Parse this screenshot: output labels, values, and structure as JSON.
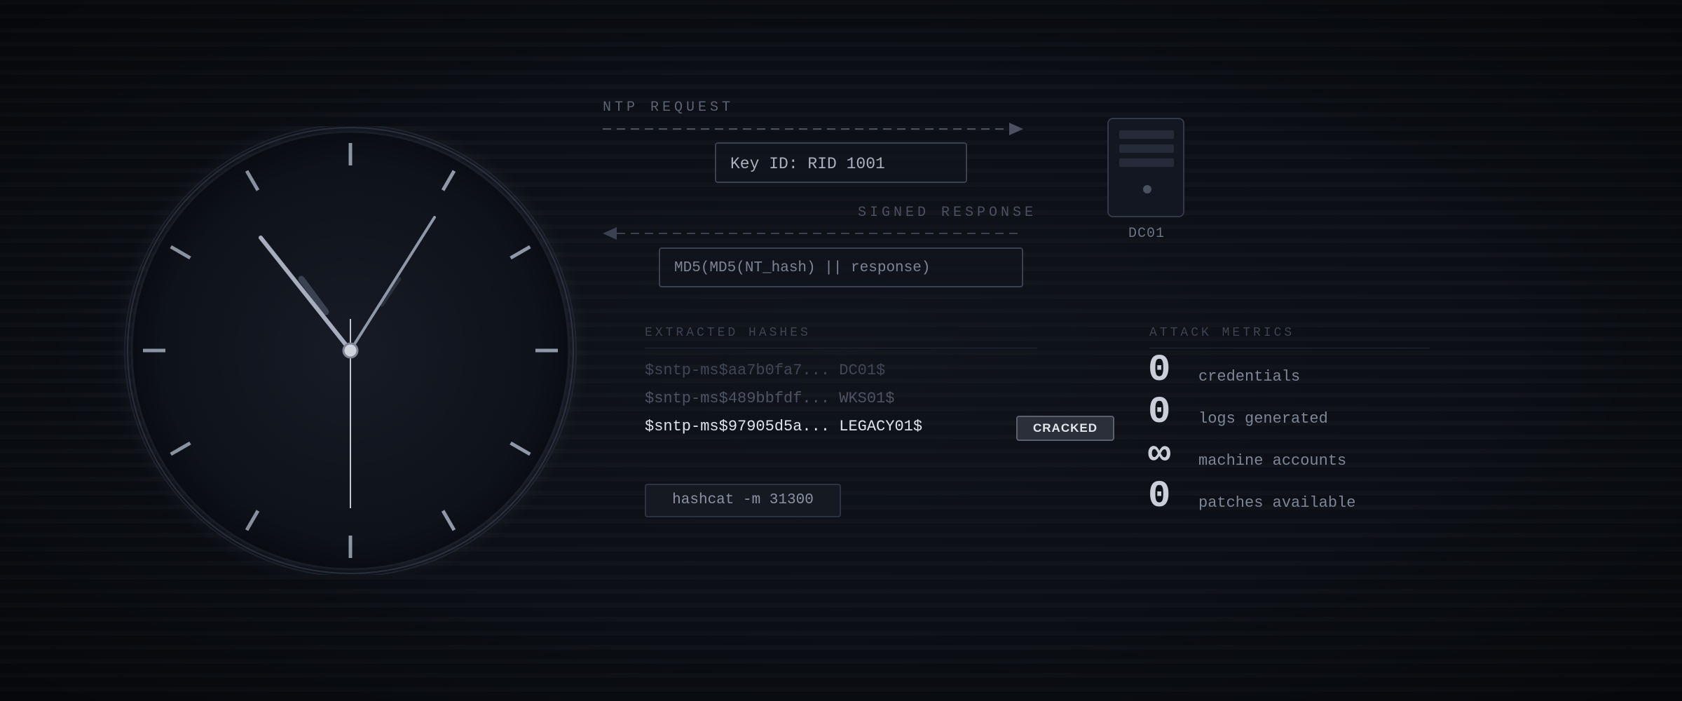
{
  "protocol": {
    "request_label": "NTP REQUEST",
    "request_payload": "Key ID: RID 1001",
    "response_label": "SIGNED RESPONSE",
    "response_payload": "MD5(MD5(NT_hash) || response)"
  },
  "server": {
    "label": "DC01"
  },
  "hashes": {
    "title": "EXTRACTED HASHES",
    "items": [
      {
        "text": "$sntp-ms$aa7b0fa7... DC01$"
      },
      {
        "text": "$sntp-ms$489bbfdf... WKS01$"
      },
      {
        "text": "$sntp-ms$97905d5a... LEGACY01$"
      }
    ],
    "cracked_badge": "CRACKED",
    "command": "hashcat -m 31300"
  },
  "metrics": {
    "title": "ATTACK METRICS",
    "items": [
      {
        "value": "0",
        "label": "credentials"
      },
      {
        "value": "0",
        "label": "logs generated"
      },
      {
        "value": "∞",
        "label": "machine accounts"
      },
      {
        "value": "0",
        "label": "patches available"
      }
    ]
  },
  "colors": {
    "background": "#0b0e14",
    "accent": "#8f98a8",
    "highlight": "#dfe3ea"
  },
  "icons": {
    "clock": "clock-icon",
    "server": "server-icon"
  }
}
